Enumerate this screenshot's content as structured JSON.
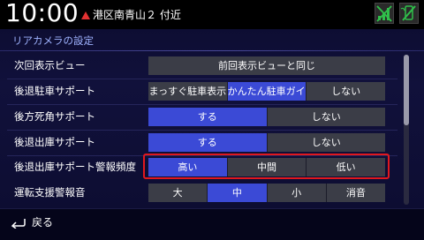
{
  "status": {
    "clock": "10:00",
    "location": "港区南青山２ 付近"
  },
  "title": "リアカメラの設定",
  "rows": [
    {
      "label": "次回表示ビュー",
      "options": [
        "前回表示ビューと同じ"
      ],
      "selected": -1
    },
    {
      "label": "後退駐車サポート",
      "options": [
        "まっすぐ駐車表示",
        "かんたん駐車ガイド",
        "しない"
      ],
      "selected": 1
    },
    {
      "label": "後方死角サポート",
      "options": [
        "する",
        "しない"
      ],
      "selected": 0
    },
    {
      "label": "後退出庫サポート",
      "options": [
        "する",
        "しない"
      ],
      "selected": 0
    },
    {
      "label": "後退出庫サポート警報頻度",
      "options": [
        "高い",
        "中間",
        "低い"
      ],
      "selected": 0
    },
    {
      "label": "運転支援警報音",
      "options": [
        "大",
        "中",
        "小",
        "消音"
      ],
      "selected": 1
    }
  ],
  "back_label": "戻る",
  "icons": {
    "status_left": "no-signal-icon",
    "status_right": "no-phone-icon",
    "back": "return-arrow-icon",
    "location_marker": "position-marker-icon"
  },
  "colors": {
    "selected": "#3b4ad6",
    "unselected": "#3b3d47",
    "highlight": "#e0181e",
    "location_marker": "#e23232"
  }
}
